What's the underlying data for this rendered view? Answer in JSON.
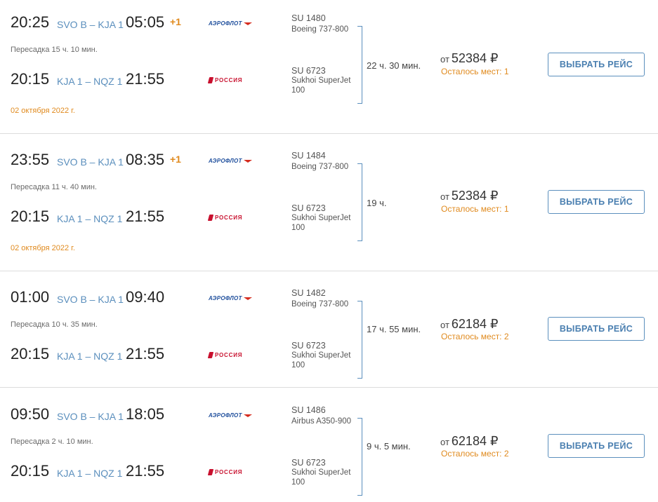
{
  "currency_symbol": "₽",
  "price_prefix": "от",
  "select_label": "ВЫБРАТЬ РЕЙС",
  "colors": {
    "accent_blue": "#5b8fbd",
    "accent_orange": "#e08a1e",
    "aeroflot_blue": "#1e4e9c",
    "rossiya_red": "#c8102e"
  },
  "results": [
    {
      "leg1": {
        "dep": "20:25",
        "route": "SVO B – KJA 1",
        "arr": "05:05",
        "next_day": "+1",
        "airline": "АЭРОФЛОТ",
        "flight": "SU 1480",
        "aircraft": "Boeing 737-800"
      },
      "transfer": "Пересадка 15 ч. 10 мин.",
      "leg2": {
        "dep": "20:15",
        "route": "KJA 1 – NQZ 1",
        "arr": "21:55",
        "airline": "РОССИЯ",
        "flight": "SU 6723",
        "aircraft": "Sukhoi SuperJet 100"
      },
      "date": "02 октября 2022 г.",
      "duration": "22 ч. 30 мин.",
      "price": "52384",
      "seats": "Осталось мест: 1"
    },
    {
      "leg1": {
        "dep": "23:55",
        "route": "SVO B – KJA 1",
        "arr": "08:35",
        "next_day": "+1",
        "airline": "АЭРОФЛОТ",
        "flight": "SU 1484",
        "aircraft": "Boeing 737-800"
      },
      "transfer": "Пересадка 11 ч. 40 мин.",
      "leg2": {
        "dep": "20:15",
        "route": "KJA 1 – NQZ 1",
        "arr": "21:55",
        "airline": "РОССИЯ",
        "flight": "SU 6723",
        "aircraft": "Sukhoi SuperJet 100"
      },
      "date": "02 октября 2022 г.",
      "duration": "19 ч.",
      "price": "52384",
      "seats": "Осталось мест: 1"
    },
    {
      "leg1": {
        "dep": "01:00",
        "route": "SVO B – KJA 1",
        "arr": "09:40",
        "airline": "АЭРОФЛОТ",
        "flight": "SU 1482",
        "aircraft": "Boeing 737-800"
      },
      "transfer": "Пересадка 10 ч. 35 мин.",
      "leg2": {
        "dep": "20:15",
        "route": "KJA 1 – NQZ 1",
        "arr": "21:55",
        "airline": "РОССИЯ",
        "flight": "SU 6723",
        "aircraft": "Sukhoi SuperJet 100"
      },
      "duration": "17 ч. 55 мин.",
      "price": "62184",
      "seats": "Осталось мест: 2"
    },
    {
      "leg1": {
        "dep": "09:50",
        "route": "SVO B – KJA 1",
        "arr": "18:05",
        "airline": "АЭРОФЛОТ",
        "flight": "SU 1486",
        "aircraft": "Airbus A350-900"
      },
      "transfer": "Пересадка 2 ч. 10 мин.",
      "leg2": {
        "dep": "20:15",
        "route": "KJA 1 – NQZ 1",
        "arr": "21:55",
        "airline": "РОССИЯ",
        "flight": "SU 6723",
        "aircraft": "Sukhoi SuperJet 100"
      },
      "duration": "9 ч. 5 мин.",
      "price": "62184",
      "seats": "Осталось мест: 2"
    }
  ]
}
